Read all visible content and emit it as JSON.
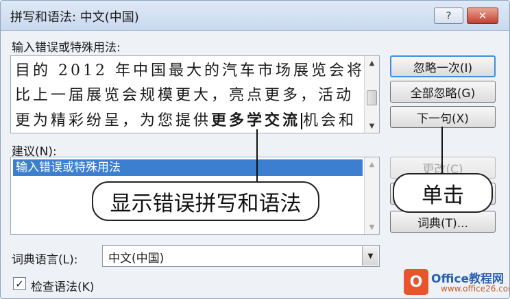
{
  "window": {
    "title": "拼写和语法: 中文(中国)",
    "help_label": "?",
    "close_label": "✕"
  },
  "input_section": {
    "label": "输入错误或特殊用法:",
    "lines": [
      "目的 2012 年中国最大的汽车市场展览会将",
      "比上一届展览会规模更大，亮点更多，活动"
    ],
    "line3_before": "更为精彩纷呈，为您提供",
    "line3_bold": "更多学交流",
    "line3_after": "机会和"
  },
  "suggestions": {
    "label": "建议(N):",
    "items": [
      "输入错误或特殊用法"
    ]
  },
  "buttons": {
    "ignore_once": "忽略一次(I)",
    "ignore_all": "全部忽略(G)",
    "next_sentence": "下一句(X)",
    "change": "更改(C)",
    "dictionary": "词典(T)..."
  },
  "dictionary_language": {
    "label": "词典语言(L):",
    "value": "中文(中国)"
  },
  "check_grammar": {
    "label": "检查语法(K)",
    "checked": true
  },
  "callouts": {
    "error": "显示错误拼写和语法",
    "click": "单击"
  },
  "watermark": {
    "logo_letter": "O",
    "text": "Office教程网",
    "url": "www.office26.com"
  },
  "colors": {
    "selection": "#3c7fd0",
    "close_button": "#c2402e",
    "focus_border": "#3d8ee0",
    "watermark_orange": "#e8542c",
    "watermark_blue": "#2b5fb0"
  }
}
